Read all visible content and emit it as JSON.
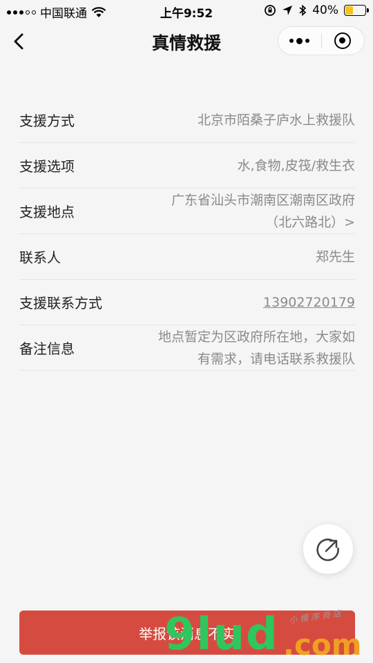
{
  "status_bar": {
    "carrier": "中国联通",
    "time": "上午9:52",
    "battery_text": "40%",
    "battery_level": 0.4
  },
  "nav": {
    "title": "真情救援"
  },
  "info": [
    {
      "label": "支援方式",
      "value": "北京市陌桑子庐水上救援队"
    },
    {
      "label": "支援选项",
      "value": "水,食物,皮筏/救生衣"
    },
    {
      "label": "支援地点",
      "value_line1": "广东省汕头市潮南区潮南区政府",
      "value_line2": "（北六路北）>"
    },
    {
      "label": "联系人",
      "value": "郑先生"
    },
    {
      "label": "支援联系方式",
      "value": "13902720179"
    },
    {
      "label": "备注信息",
      "value_line1": "地点暂定为区政府所在地，大家如",
      "value_line2": "有需求，请电话联系救援队"
    }
  ],
  "report_button": {
    "label": "举报该消息不实"
  },
  "watermark": {
    "brand": "9lud",
    "suffix": ".com",
    "tagline": "小模序商店"
  },
  "colors": {
    "report_red": "#d64b3f",
    "watermark_green": "#2fc65f",
    "watermark_orange": "#f0a020",
    "battery_yellow": "#f5c518"
  }
}
